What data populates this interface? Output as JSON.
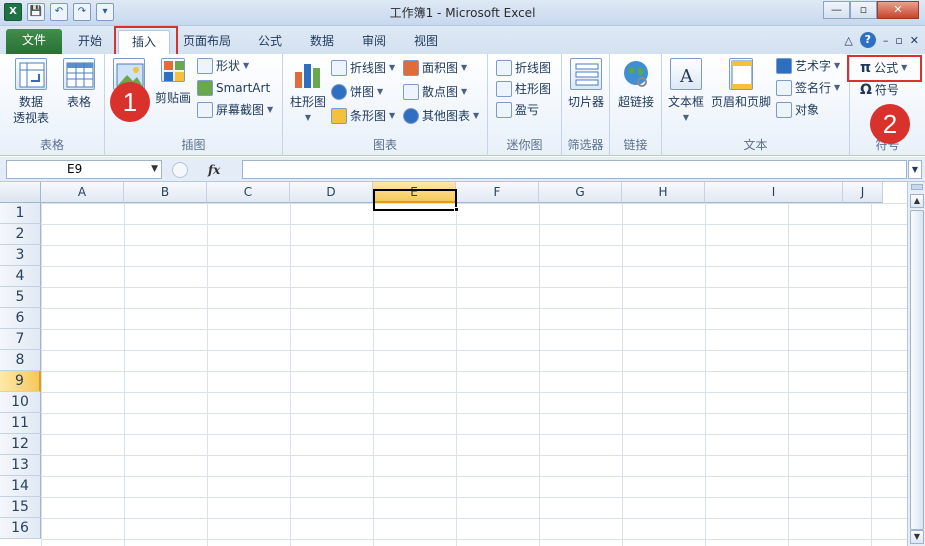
{
  "title": "工作簿1 - Microsoft Excel",
  "qat": {
    "excel": "X",
    "save": "💾",
    "undo": "↶",
    "redo": "↷",
    "customize": "▾"
  },
  "window": {
    "min": "—",
    "max": "▫",
    "close": "✕"
  },
  "tabs": [
    {
      "label": "文件"
    },
    {
      "label": "开始"
    },
    {
      "label": "插入"
    },
    {
      "label": "页面布局"
    },
    {
      "label": "公式"
    },
    {
      "label": "数据"
    },
    {
      "label": "审阅"
    },
    {
      "label": "视图"
    }
  ],
  "tabright": {
    "collapse": "△",
    "help": "?",
    "min": "–",
    "restore": "▫",
    "close": "✕"
  },
  "ribbon": {
    "tables": {
      "label": "表格",
      "pivot": "数据\n透视表",
      "table": "表格"
    },
    "illus": {
      "label": "插图",
      "clipart": "剪贴画",
      "shapes": "形状",
      "smartart": "SmartArt",
      "screenshot": "屏幕截图"
    },
    "charts": {
      "label": "图表",
      "column": "柱形图",
      "line": "折线图",
      "pie": "饼图",
      "bar": "条形图",
      "area": "面积图",
      "scatter": "散点图",
      "other": "其他图表"
    },
    "sparklines": {
      "label": "迷你图",
      "line": "折线图",
      "column": "柱形图",
      "winloss": "盈亏"
    },
    "filter": {
      "label": "筛选器",
      "slicer": "切片器"
    },
    "links": {
      "label": "链接",
      "hyperlink": "超链接"
    },
    "text": {
      "label": "文本",
      "textbox": "文本框",
      "headerfooter": "页眉和页脚",
      "wordart": "艺术字",
      "signature": "签名行",
      "object": "对象"
    },
    "symbols": {
      "label": "符号",
      "equation": "公式",
      "equation_glyph": "π",
      "symbol": "符号",
      "symbol_glyph": "Ω"
    }
  },
  "badges": {
    "one": "1",
    "two": "2"
  },
  "namebox": "E9",
  "fx": "fx",
  "columns": [
    "A",
    "B",
    "C",
    "D",
    "E",
    "F",
    "G",
    "H",
    "I",
    "J"
  ],
  "rows": [
    "1",
    "2",
    "3",
    "4",
    "5",
    "6",
    "7",
    "8",
    "9",
    "10",
    "11",
    "12",
    "13",
    "14",
    "15",
    "16"
  ],
  "colors": {
    "file_tab": "#2a7035",
    "highlight": "#d9312c",
    "selected_header": "#f6c85a"
  }
}
